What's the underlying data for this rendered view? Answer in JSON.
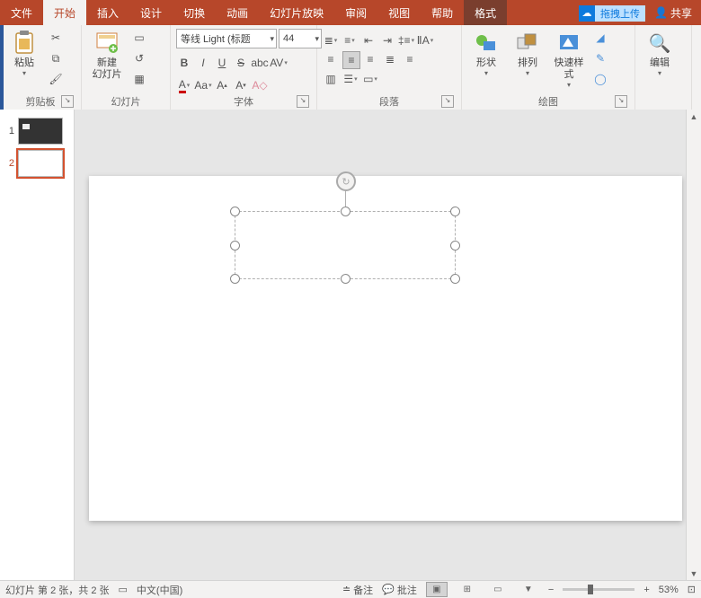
{
  "tabs": {
    "file": "文件",
    "home": "开始",
    "insert": "插入",
    "design": "设计",
    "transition": "切换",
    "animation": "动画",
    "slideshow": "幻灯片放映",
    "review": "审阅",
    "view": "视图",
    "help": "帮助",
    "format": "格式"
  },
  "upload": {
    "label": "拖拽上传"
  },
  "share": {
    "label": "共享"
  },
  "groups": {
    "clipboard": "剪贴板",
    "slides": "幻灯片",
    "font": "字体",
    "paragraph": "段落",
    "drawing": "绘图"
  },
  "buttons": {
    "paste": "粘贴",
    "new_slide": "新建\n幻灯片",
    "shapes": "形状",
    "arrange": "排列",
    "quickstyles": "快速样式",
    "editing": "编辑"
  },
  "font": {
    "name": "等线 Light (标题",
    "size": "44"
  },
  "thumbs": {
    "n1": "1",
    "n2": "2"
  },
  "status": {
    "slide_info": "幻灯片 第 2 张，共 2 张",
    "lang": "中文(中国)",
    "notes": "备注",
    "comments": "批注",
    "zoom": "53%"
  },
  "zoom": {
    "minus": "−",
    "plus": "+"
  }
}
